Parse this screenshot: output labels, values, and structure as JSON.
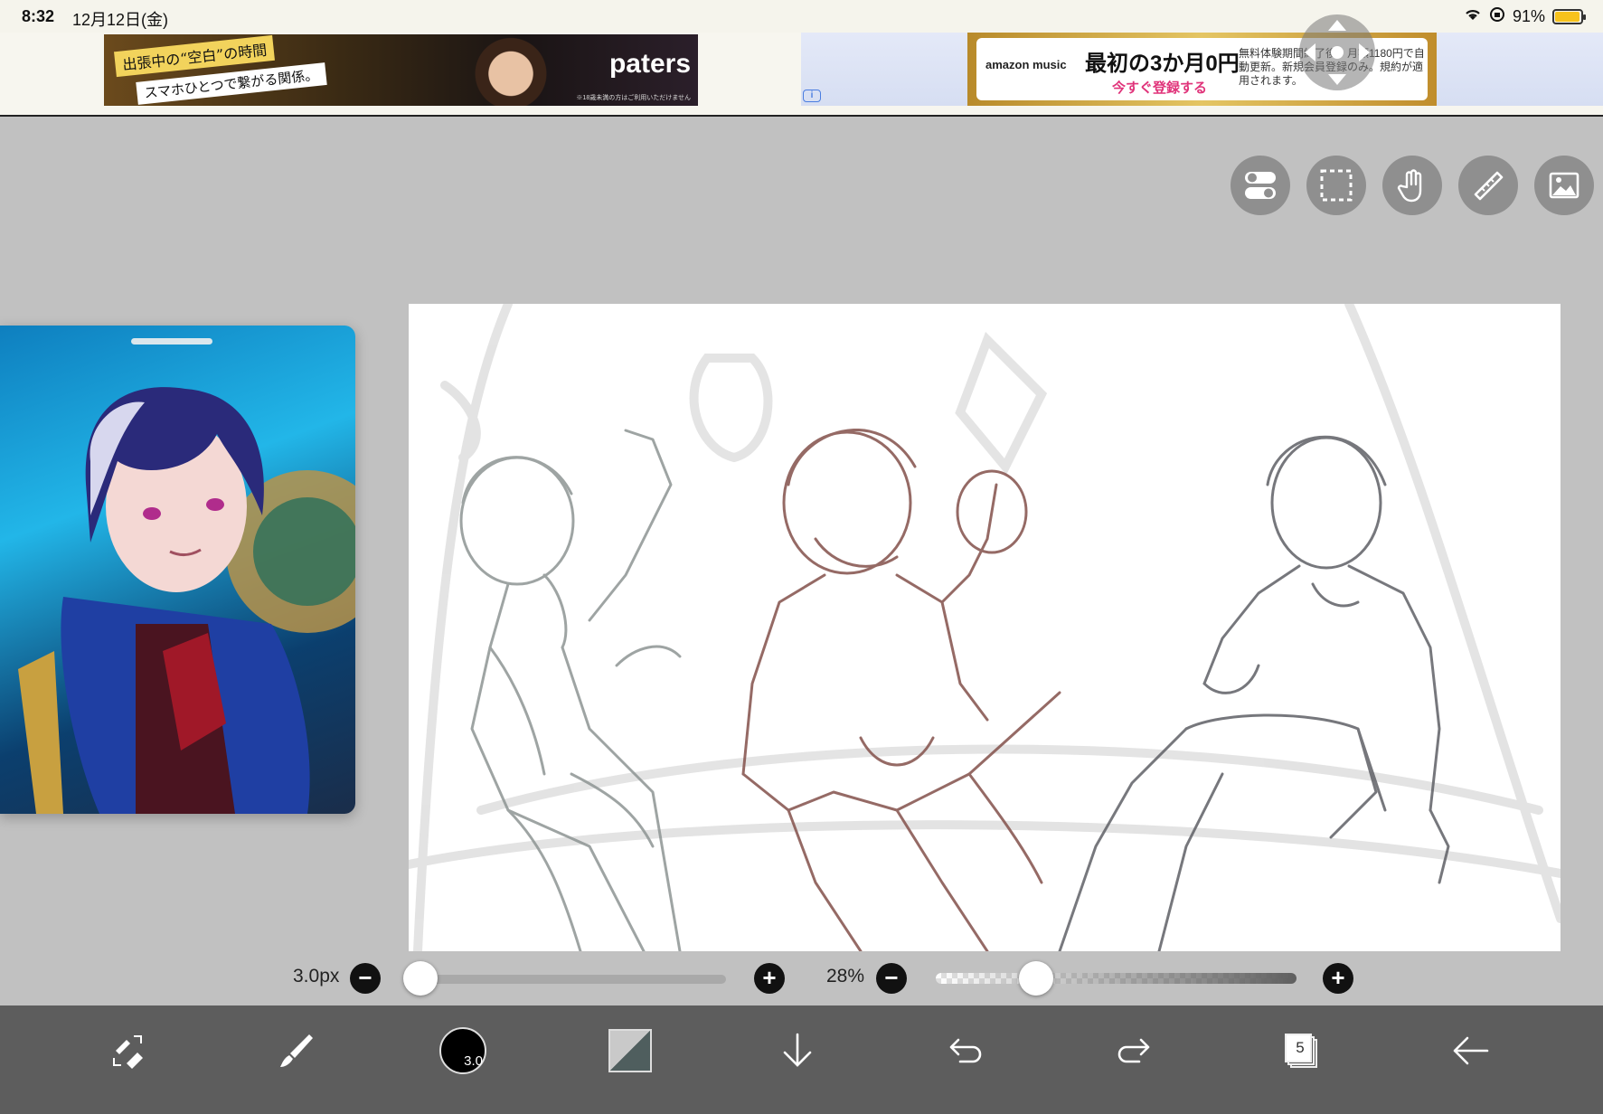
{
  "status_bar": {
    "time": "8:32",
    "date": "12月12日(金)",
    "battery": "91%"
  },
  "ads": {
    "left": {
      "headline": "出張中の“空白”の時間",
      "subline": "スマホひとつで繋がる関係。",
      "brand": "paters",
      "fine_print": "※18歳未満の方はご利用いただけません"
    },
    "right": {
      "logo": "amazon music",
      "headline": "最初の3か月0円",
      "cta": "今すぐ登録する",
      "fine_print": "無料体験期間終了後、月額1180円で自動更新。新規会員登録のみ。規約が適用されます。"
    }
  },
  "top_tools": [
    {
      "name": "toggle-tool",
      "icon": "toggle-switch-icon"
    },
    {
      "name": "selection-tool",
      "icon": "dashed-selection-icon"
    },
    {
      "name": "hand-tool",
      "icon": "hand-icon"
    },
    {
      "name": "ruler-tool",
      "icon": "ruler-icon"
    },
    {
      "name": "image-tool",
      "icon": "image-icon"
    }
  ],
  "sliders": {
    "brush_size": {
      "label": "3.0px",
      "minus": "−",
      "plus": "+"
    },
    "opacity": {
      "label": "28%",
      "minus": "−",
      "plus": "+"
    }
  },
  "toolbar": {
    "brush_size_label": "3.0",
    "layers_count": "5"
  },
  "colors": {
    "bg": "#c1c1c1",
    "toolbar": "#5d5d5d",
    "sketch_gray": "#8e9594",
    "sketch_brown": "#8a5a55",
    "sketch_dark": "#5f6066"
  }
}
